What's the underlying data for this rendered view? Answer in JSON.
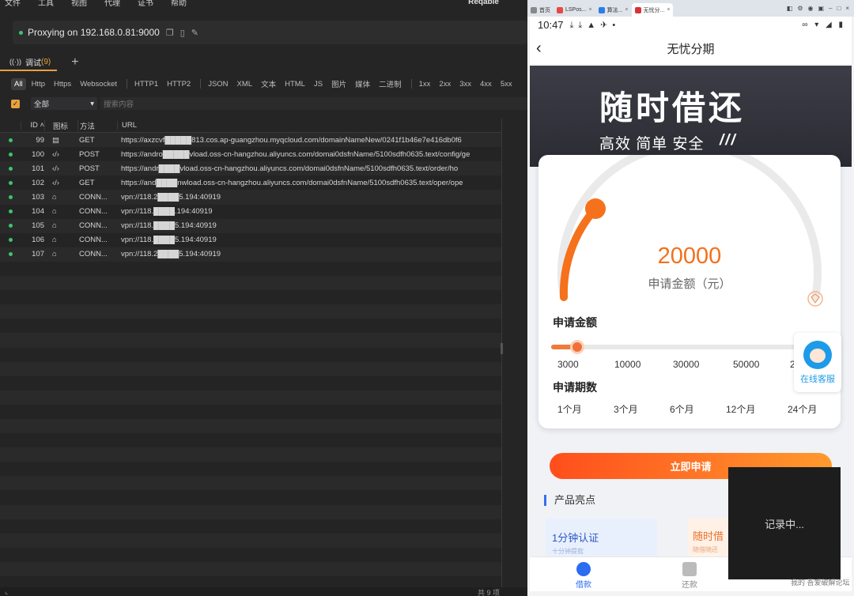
{
  "menu": {
    "items": [
      "文件",
      "工具",
      "视图",
      "代理",
      "证书",
      "帮助"
    ],
    "brand": "Reqable"
  },
  "proxy": {
    "text": "Proxying on 192.168.0.81:9000"
  },
  "tab": {
    "label": "调试",
    "count": "(9)"
  },
  "filters": [
    "All",
    "Http",
    "Https",
    "Websocket",
    "|",
    "HTTP1",
    "HTTP2",
    "|",
    "JSON",
    "XML",
    "文本",
    "HTML",
    "JS",
    "图片",
    "媒体",
    "二进制",
    "|",
    "1xx",
    "2xx",
    "3xx",
    "4xx",
    "5xx"
  ],
  "search": {
    "select": "全部",
    "placeholder": "搜索内容"
  },
  "table": {
    "headers": {
      "id": "ID",
      "icon": "图标",
      "method": "方法",
      "url": "URL"
    },
    "rows": [
      {
        "id": "99",
        "icon": "doc-icon",
        "method": "GET",
        "url": "https://axzcvf█████813.cos.ap-guangzhou.myqcloud.com/domainNameNew/0241f1b46e7e416db0f6"
      },
      {
        "id": "100",
        "icon": "code-icon",
        "method": "POST",
        "url": "https://andro█████vload.oss-cn-hangzhou.aliyuncs.com/domai0dsfnName/5100sdfh0635.text/config/ge"
      },
      {
        "id": "101",
        "icon": "code-icon",
        "method": "POST",
        "url": "https://andr████vload.oss-cn-hangzhou.aliyuncs.com/domai0dsfnName/5100sdfh0635.text/order/ho"
      },
      {
        "id": "102",
        "icon": "code-icon",
        "method": "GET",
        "url": "https://and████nwload.oss-cn-hangzhou.aliyuncs.com/domai0dsfnName/5100sdfh0635.text/oper/ope"
      },
      {
        "id": "103",
        "icon": "lock-icon",
        "method": "CONN...",
        "url": "vpn://118.2████5.194:40919"
      },
      {
        "id": "104",
        "icon": "lock-icon",
        "method": "CONN...",
        "url": "vpn://118.████.194:40919"
      },
      {
        "id": "105",
        "icon": "lock-icon",
        "method": "CONN...",
        "url": "vpn://118.████5.194:40919"
      },
      {
        "id": "106",
        "icon": "lock-icon",
        "method": "CONN...",
        "url": "vpn://118.████5.194:40919"
      },
      {
        "id": "107",
        "icon": "lock-icon",
        "method": "CONN...",
        "url": "vpn://118.2████5.194:40919"
      }
    ]
  },
  "statusbar": {
    "total": "共 9 项"
  },
  "chrome": {
    "tabs": [
      "首页",
      "LSPos...",
      "算法...",
      "无忧分..."
    ]
  },
  "phone": {
    "time": "10:47",
    "title": "无忧分期",
    "hero": {
      "big": "随时借还",
      "sub": "高效 简单 安全",
      "slash": "///"
    },
    "amount": "20000",
    "amount_label": "申请金额（元）",
    "label_amount": "申请金额",
    "amounts": [
      "3000",
      "10000",
      "30000",
      "50000",
      "2"
    ],
    "label_term": "申请期数",
    "terms": [
      "1个月",
      "3个月",
      "6个月",
      "12个月",
      "24个月"
    ],
    "support": "在线客服",
    "apply": "立即申请",
    "highlights": "产品亮点",
    "feat1": {
      "title": "1分钟认证",
      "sub": "十分钟提款"
    },
    "feat2": {
      "title": "随时借",
      "sub": "随借随还"
    },
    "tabbar": [
      "借款",
      "还款"
    ],
    "slider_value": 0.0
  },
  "overlay": {
    "recording": "记录中..."
  },
  "watermark": "我的 吾爱破解论坛"
}
